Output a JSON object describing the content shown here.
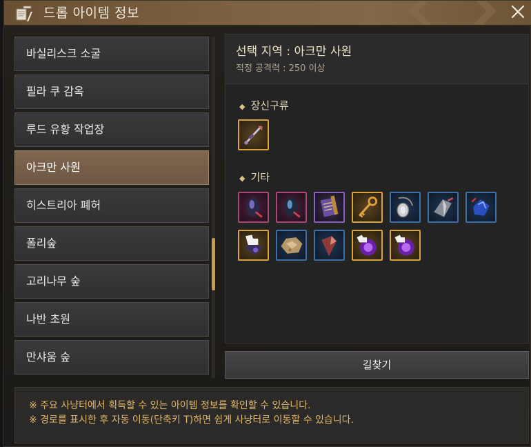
{
  "window": {
    "title": "드롭 아이템 정보"
  },
  "regions": [
    {
      "label": "바실리스크 소굴",
      "selected": false
    },
    {
      "label": "필라 쿠 감옥",
      "selected": false
    },
    {
      "label": "루드 유황 작업장",
      "selected": false
    },
    {
      "label": "아크만 사원",
      "selected": true
    },
    {
      "label": "히스트리아 폐허",
      "selected": false
    },
    {
      "label": "폴리숲",
      "selected": false
    },
    {
      "label": "고리나무 숲",
      "selected": false
    },
    {
      "label": "나반 초원",
      "selected": false
    },
    {
      "label": "만샤움 숲",
      "selected": false
    }
  ],
  "detail": {
    "region_title": "선택 지역 : 아크만 사원",
    "power_requirement": "적정 공격력 : 250 이상",
    "sections": [
      {
        "label": "장신구류",
        "items": [
          {
            "icon": "necklace-accessory-icon",
            "grade": "legend"
          }
        ]
      },
      {
        "label": "기타",
        "items": [
          {
            "icon": "purple-crystal-icon",
            "grade": "epic"
          },
          {
            "icon": "blue-crystal-icon",
            "grade": "epic"
          },
          {
            "icon": "scroll-map-icon",
            "grade": "hero"
          },
          {
            "icon": "golden-key-icon",
            "grade": "legend"
          },
          {
            "icon": "silver-pendant-icon",
            "grade": "rare"
          },
          {
            "icon": "spike-shard-icon",
            "grade": "rare"
          },
          {
            "icon": "blue-ore-icon",
            "grade": "rare"
          },
          {
            "icon": "armor-box-icon",
            "grade": "legend"
          },
          {
            "icon": "rough-stone-icon",
            "grade": "rare"
          },
          {
            "icon": "red-shard-icon",
            "grade": "rare"
          },
          {
            "icon": "purple-orb-box-icon",
            "grade": "legend"
          },
          {
            "icon": "purple-orb-box-icon",
            "grade": "legend"
          }
        ]
      }
    ]
  },
  "buttons": {
    "find_route": "길찾기"
  },
  "notes": [
    "※ 주요 사냥터에서 획득할 수 있는 아이템 정보를 확인할 수 있습니다.",
    "※ 경로를 표시한 후 자동 이동(단축키 T)하면 쉽게 사냥터로 이동할 수 있습니다."
  ],
  "colors": {
    "accent_gold": "#e0b869",
    "selected_item": "#7f6650",
    "scroll_thumb": "#c79a52"
  }
}
